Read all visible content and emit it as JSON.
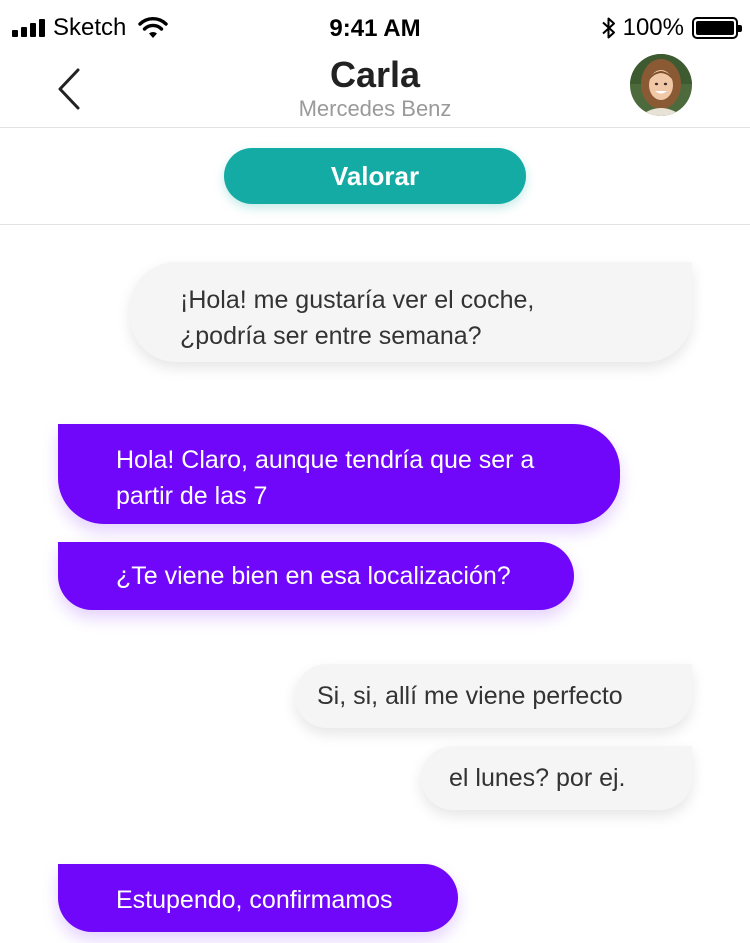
{
  "status_bar": {
    "carrier": "Sketch",
    "time": "9:41 AM",
    "battery": "100%"
  },
  "header": {
    "name": "Carla",
    "subtitle": "Mercedes Benz"
  },
  "rating": {
    "button_label": "Valorar"
  },
  "messages": [
    {
      "direction": "incoming",
      "text": "¡Hola! me gustaría ver el coche,\n¿podría ser entre semana?"
    },
    {
      "direction": "outgoing",
      "text": "Hola! Claro, aunque tendría que ser a\npartir de las 7"
    },
    {
      "direction": "outgoing",
      "text": "¿Te viene bien en esa localización?"
    },
    {
      "direction": "incoming",
      "text": "Si, si, allí me viene perfecto"
    },
    {
      "direction": "incoming",
      "text": "el lunes? por ej."
    },
    {
      "direction": "outgoing",
      "text": "Estupendo, confirmamos"
    }
  ],
  "colors": {
    "outgoing_bubble": "#7007fb",
    "incoming_bubble": "#f5f5f5",
    "rate_button": "#14aba4"
  },
  "icons": {
    "back": "chevron-left-icon",
    "wifi": "wifi-icon",
    "bluetooth": "bluetooth-icon",
    "signal": "signal-icon",
    "battery": "battery-icon"
  }
}
